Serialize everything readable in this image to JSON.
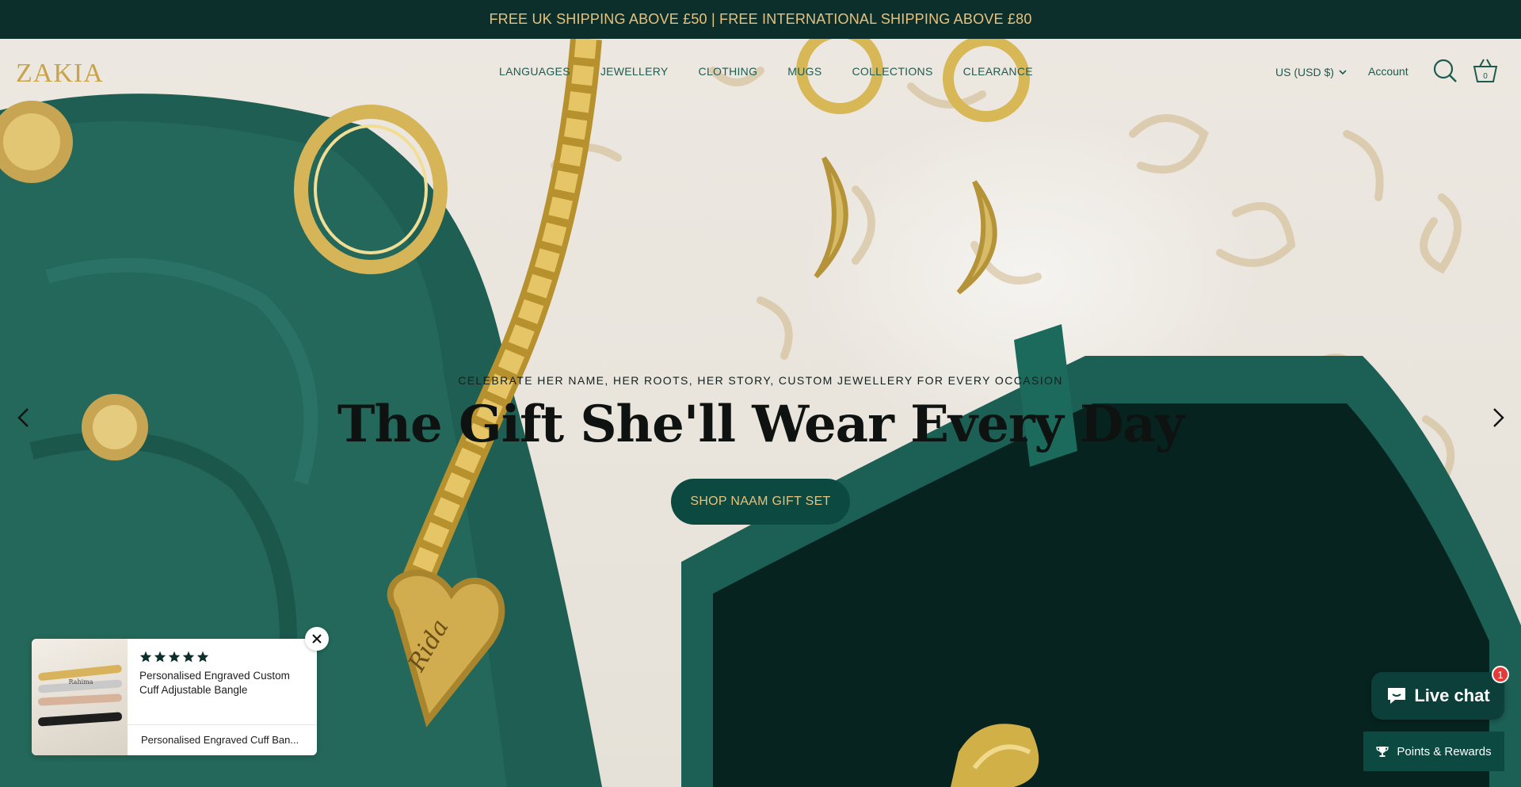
{
  "announcement": {
    "text": "FREE UK SHIPPING ABOVE £50 | FREE INTERNATIONAL SHIPPING ABOVE £80"
  },
  "header": {
    "logo": "ZAKIA",
    "nav": [
      "LANGUAGES",
      "JEWELLERY",
      "CLOTHING",
      "MUGS",
      "COLLECTIONS",
      "CLEARANCE"
    ],
    "currency": "US (USD $)",
    "account": "Account",
    "cart_count": "0",
    "icons": {
      "search": "search-icon",
      "cart": "basket-icon",
      "currency_caret": "chevron-down-icon"
    }
  },
  "hero": {
    "eyebrow": "CELEBRATE HER NAME, HER ROOTS, HER STORY, CUSTOM JEWELLERY FOR EVERY OCCASION",
    "headline": "The Gift She'll Wear Every Day",
    "cta": "SHOP NAAM GIFT SET",
    "engraving": "Rida",
    "prev_icon": "chevron-left-icon",
    "next_icon": "chevron-right-icon"
  },
  "review_popup": {
    "rating": 5,
    "title": "Personalised Engraved Custom Cuff Adjustable Bangle",
    "product": "Personalised Engraved Cuff Ban...",
    "close_icon": "close-icon",
    "image_labels": [
      "Rahima"
    ]
  },
  "chat": {
    "label": "Live chat",
    "badge": "1",
    "icon": "chat-bubble-icon"
  },
  "rewards": {
    "label": "Points & Rewards",
    "icon": "trophy-icon"
  },
  "colors": {
    "dark_green": "#0c2f2c",
    "brand_green": "#0c4a41",
    "gold": "#e7c27d",
    "nav_green": "#1d5b4f"
  }
}
